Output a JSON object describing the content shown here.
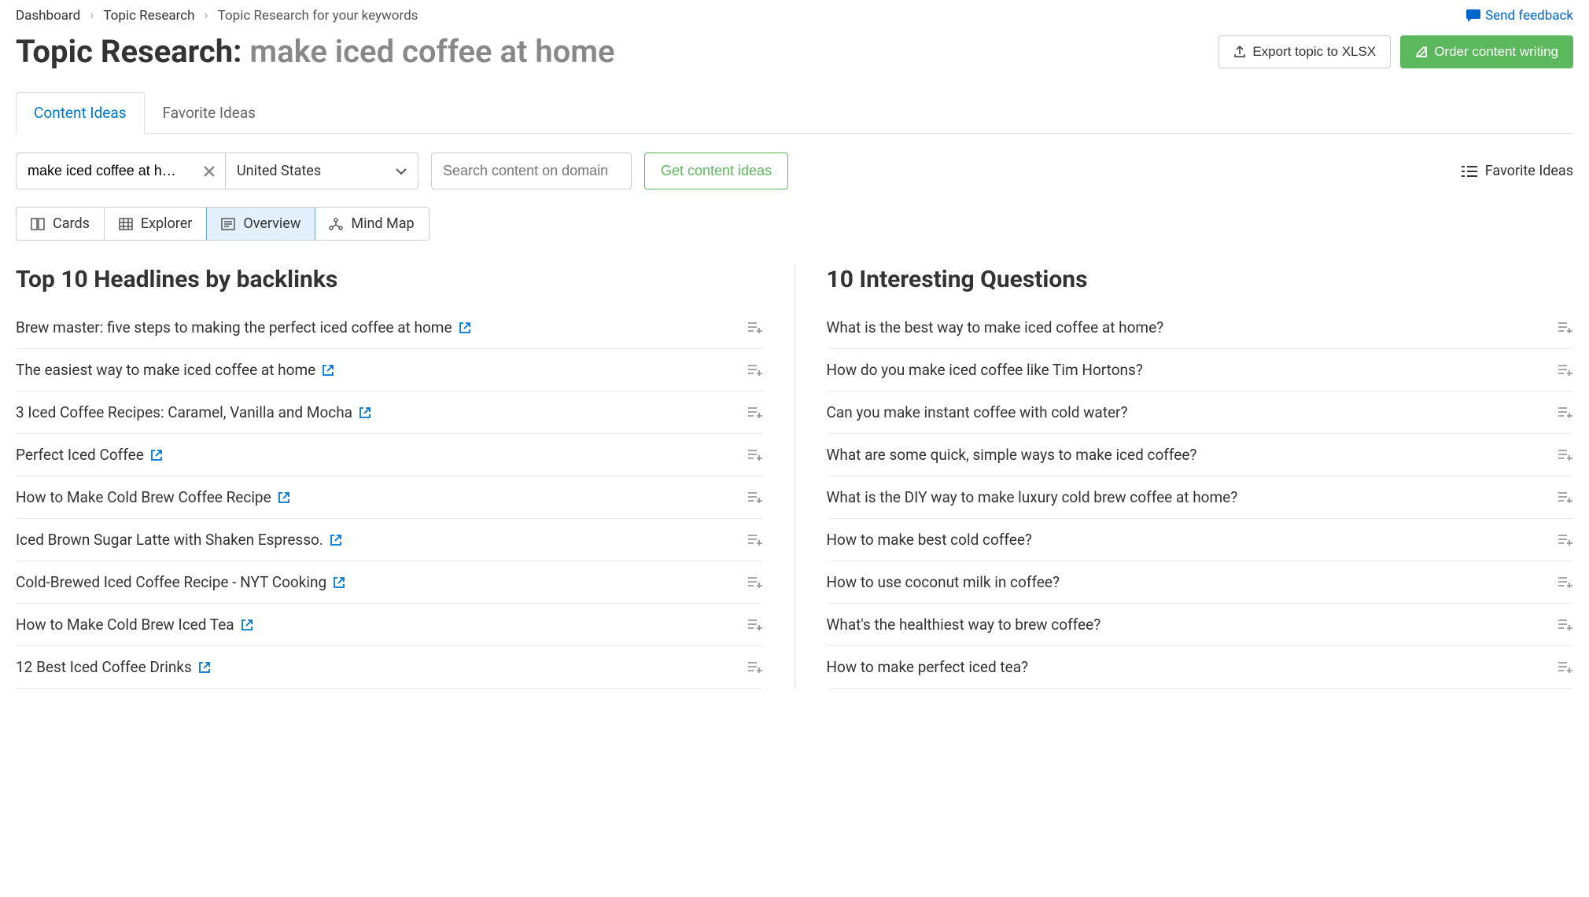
{
  "breadcrumb": {
    "items": [
      "Dashboard",
      "Topic Research",
      "Topic Research for your keywords"
    ]
  },
  "send_feedback": "Send feedback",
  "page_title_prefix": "Topic Research: ",
  "page_title_query": "make iced coffee at home",
  "header_actions": {
    "export": "Export topic to XLSX",
    "order": "Order content writing"
  },
  "tabs": {
    "content_ideas": "Content Ideas",
    "favorite_ideas": "Favorite Ideas"
  },
  "filters": {
    "keyword": "make iced coffee at ho…",
    "country": "United States",
    "domain_placeholder": "Search content on domain",
    "get_ideas": "Get content ideas",
    "favorite_ideas_link": "Favorite Ideas"
  },
  "view_tabs": {
    "cards": "Cards",
    "explorer": "Explorer",
    "overview": "Overview",
    "mindmap": "Mind Map"
  },
  "headlines": {
    "title": "Top 10 Headlines by backlinks",
    "items": [
      "Brew master: five steps to making the perfect iced coffee at home",
      "The easiest way to make iced coffee at home",
      "3 Iced Coffee Recipes: Caramel, Vanilla and Mocha",
      "Perfect Iced Coffee",
      "How to Make Cold Brew Coffee Recipe",
      "Iced Brown Sugar Latte with Shaken Espresso.",
      "Cold-Brewed Iced Coffee Recipe - NYT Cooking",
      "How to Make Cold Brew Iced Tea",
      "12 Best Iced Coffee Drinks"
    ]
  },
  "questions": {
    "title": "10 Interesting Questions",
    "items": [
      "What is the best way to make iced coffee at home?",
      "How do you make iced coffee like Tim Hortons?",
      "Can you make instant coffee with cold water?",
      "What are some quick, simple ways to make iced coffee?",
      "What is the DIY way to make luxury cold brew coffee at home?",
      "How to make best cold coffee?",
      "How to use coconut milk in coffee?",
      "What's the healthiest way to brew coffee?",
      "How to make perfect iced tea?"
    ]
  }
}
